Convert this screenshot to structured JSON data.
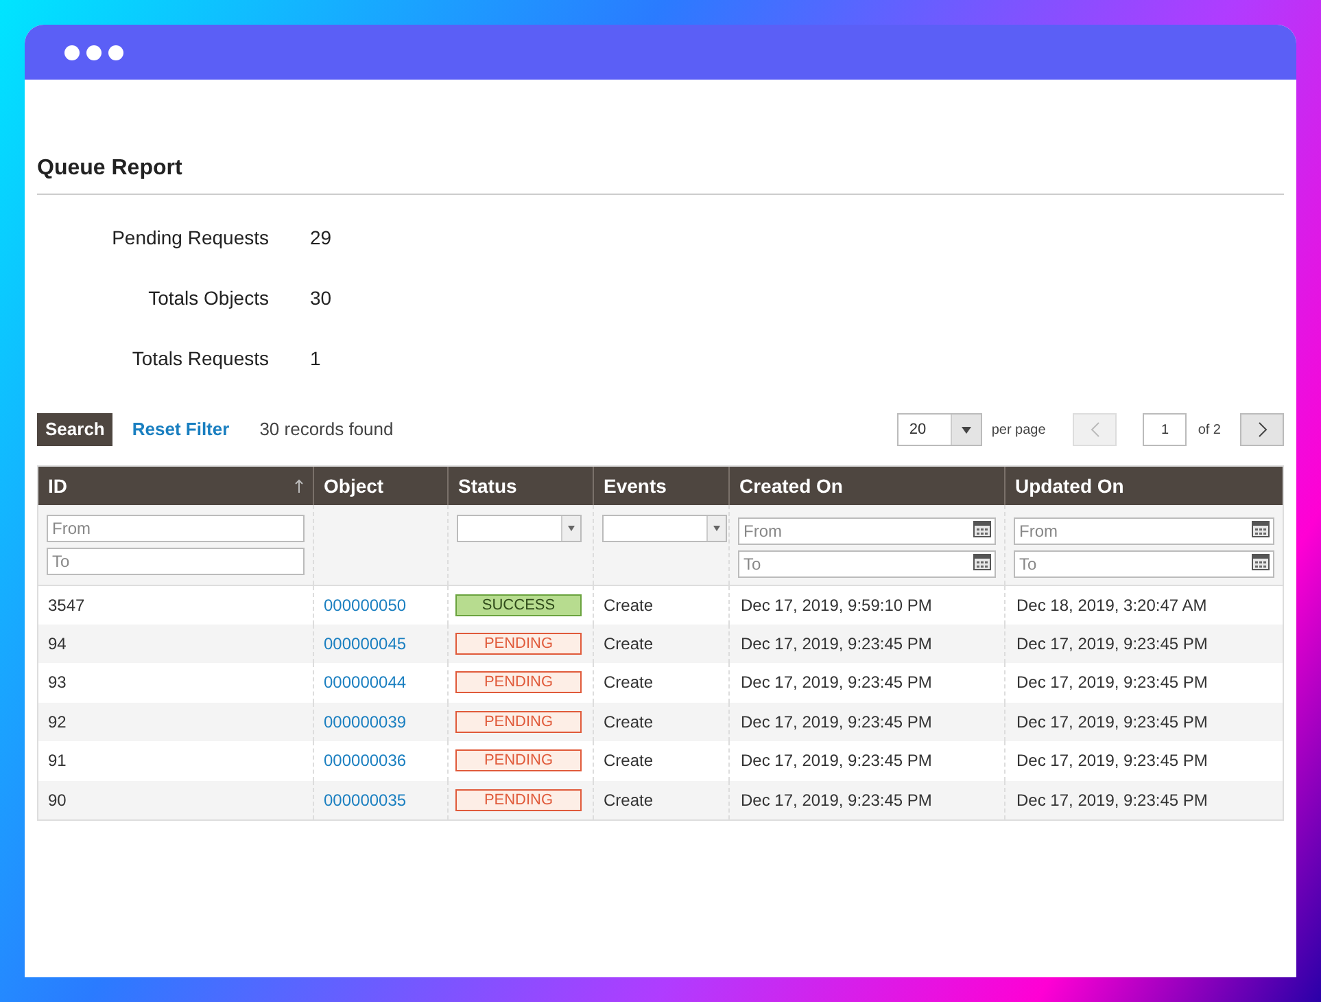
{
  "title": "Queue Report",
  "stats": [
    {
      "label": "Pending Requests",
      "value": "29"
    },
    {
      "label": "Totals Objects",
      "value": "30"
    },
    {
      "label": "Totals Requests",
      "value": "1"
    }
  ],
  "toolbar": {
    "search_button": "Search",
    "reset_link": "Reset Filter",
    "records": "30 records found"
  },
  "pagination": {
    "page_size": "20",
    "per_page": "per page",
    "page": "1",
    "of": "of 2",
    "prev_disabled": true,
    "next_disabled": false
  },
  "table": {
    "columns": [
      {
        "label": "ID",
        "sorted": true,
        "filter": {
          "kind": "range",
          "from": {
            "placeholder": "From"
          },
          "to": {
            "placeholder": "To"
          }
        }
      },
      {
        "label": "Object",
        "sorted": false,
        "filter": {
          "kind": "none"
        }
      },
      {
        "label": "Status",
        "sorted": false,
        "filter": {
          "kind": "select"
        }
      },
      {
        "label": "Events",
        "sorted": false,
        "filter": {
          "kind": "select"
        }
      },
      {
        "label": "Created On",
        "sorted": false,
        "filter": {
          "kind": "date_range",
          "from": {
            "placeholder": "From"
          },
          "to": {
            "placeholder": "To"
          }
        }
      },
      {
        "label": "Updated On",
        "sorted": false,
        "filter": {
          "kind": "date_range",
          "from": {
            "placeholder": "From"
          },
          "to": {
            "placeholder": "To"
          }
        }
      }
    ],
    "rows": [
      {
        "id": "3547",
        "object": "000000050",
        "status": "SUCCESS",
        "kind": "success",
        "event": "Create",
        "created": "Dec 17, 2019, 9:59:10 PM",
        "updated": "Dec 18, 2019, 3:20:47 AM"
      },
      {
        "id": "94",
        "object": "000000045",
        "status": "PENDING",
        "kind": "pending",
        "event": "Create",
        "created": "Dec 17, 2019, 9:23:45 PM",
        "updated": "Dec 17, 2019, 9:23:45 PM"
      },
      {
        "id": "93",
        "object": "000000044",
        "status": "PENDING",
        "kind": "pending",
        "event": "Create",
        "created": "Dec 17, 2019, 9:23:45 PM",
        "updated": "Dec 17, 2019, 9:23:45 PM"
      },
      {
        "id": "92",
        "object": "000000039",
        "status": "PENDING",
        "kind": "pending",
        "event": "Create",
        "created": "Dec 17, 2019, 9:23:45 PM",
        "updated": "Dec 17, 2019, 9:23:45 PM"
      },
      {
        "id": "91",
        "object": "000000036",
        "status": "PENDING",
        "kind": "pending",
        "event": "Create",
        "created": "Dec 17, 2019, 9:23:45 PM",
        "updated": "Dec 17, 2019, 9:23:45 PM"
      },
      {
        "id": "90",
        "object": "000000035",
        "status": "PENDING",
        "kind": "pending",
        "event": "Create",
        "created": "Dec 17, 2019, 9:23:45 PM",
        "updated": "Dec 17, 2019, 9:23:45 PM"
      }
    ]
  }
}
